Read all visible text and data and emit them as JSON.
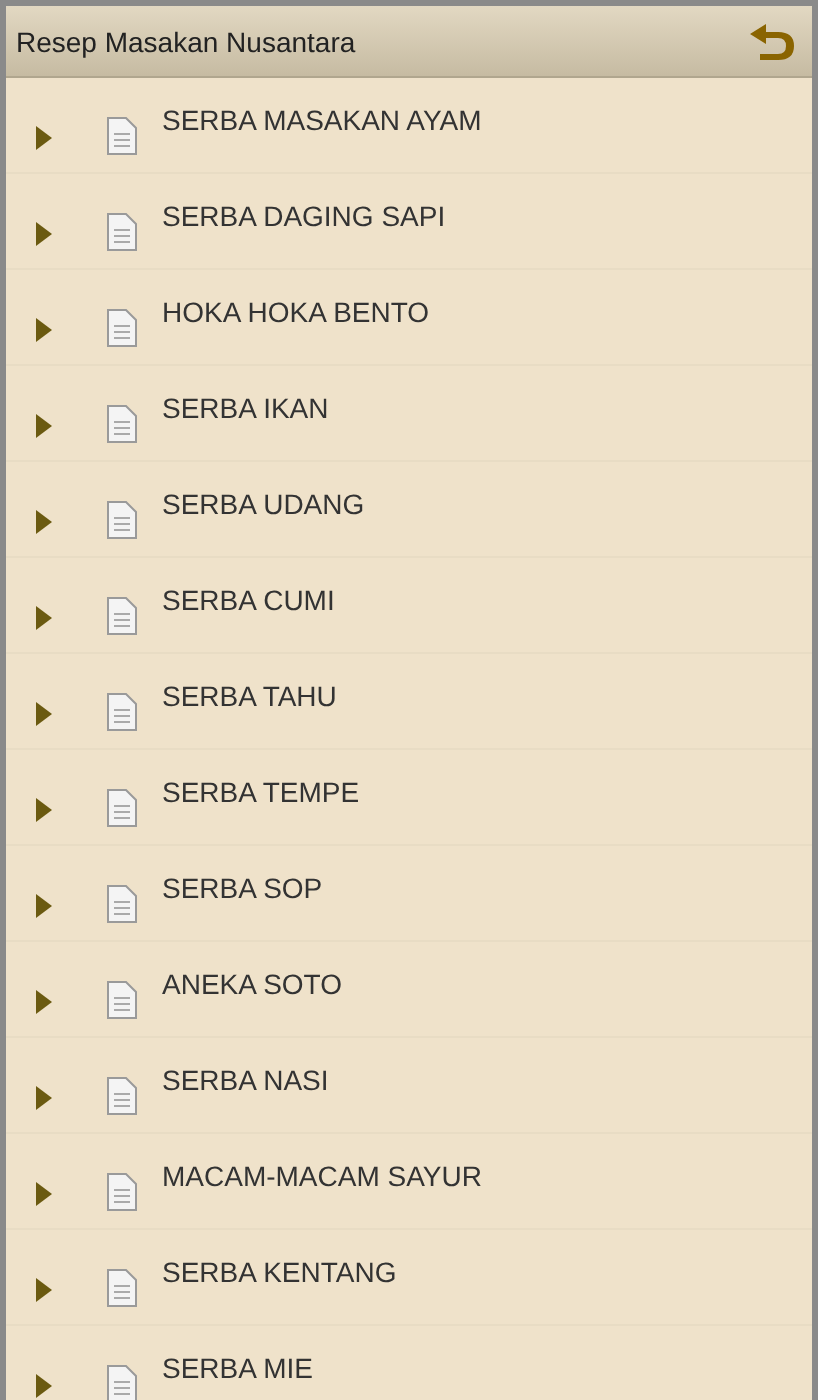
{
  "header": {
    "title": "Resep Masakan Nusantara"
  },
  "categories": [
    {
      "label": "SERBA MASAKAN AYAM",
      "expanded": false
    },
    {
      "label": "SERBA DAGING SAPI",
      "expanded": false
    },
    {
      "label": "HOKA HOKA BENTO",
      "expanded": false
    },
    {
      "label": "SERBA IKAN",
      "expanded": false
    },
    {
      "label": "SERBA UDANG",
      "expanded": false
    },
    {
      "label": "SERBA CUMI",
      "expanded": false
    },
    {
      "label": "SERBA TAHU",
      "expanded": false
    },
    {
      "label": "SERBA TEMPE",
      "expanded": false
    },
    {
      "label": "SERBA SOP",
      "expanded": false
    },
    {
      "label": "ANEKA SOTO",
      "expanded": false
    },
    {
      "label": "SERBA NASI",
      "expanded": false
    },
    {
      "label": "MACAM-MACAM SAYUR",
      "expanded": false
    },
    {
      "label": "SERBA KENTANG",
      "expanded": false
    },
    {
      "label": "SERBA MIE",
      "expanded": false
    }
  ]
}
